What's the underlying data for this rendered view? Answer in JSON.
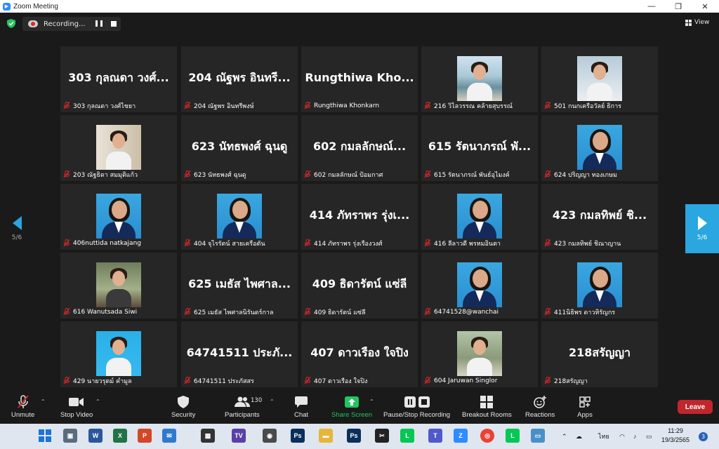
{
  "window": {
    "title": "Zoom Meeting"
  },
  "recording": {
    "label": "Recording..."
  },
  "view": {
    "label": "View"
  },
  "pager": {
    "left": "5/6",
    "right": "5/6"
  },
  "tiles": [
    {
      "big": "303 กุลณดา  วงศ์...",
      "name": "303 กุลณดา  วงศ์ไชยา"
    },
    {
      "big": "204 ณัฐพร อินทรี...",
      "name": "204 ณัฐพร อินทรีพงษ์"
    },
    {
      "big": "Rungthiwa  Kho...",
      "name": "Rungthiwa Khonkarn"
    },
    {
      "big": "",
      "name": "216 วิไลวรรณ คล้ายสุบรรณ์",
      "photo": "photo1"
    },
    {
      "big": "",
      "name": "501 กนกเครือวัลย์ ธิการ",
      "photo": "photo2"
    },
    {
      "big": "",
      "name": "203 ณัฐธิดา สมมุติแก้ว",
      "photo": "photo3"
    },
    {
      "big": "623 นัทธพงศ์ ฉุนดู",
      "name": "623 นัทธพงศ์ ฉุนดู"
    },
    {
      "big": "602 กมลลักษณ์...",
      "name": "602 กมลลักษณ์ ป้อมกาศ"
    },
    {
      "big": "615 รัตนาภรณ์ พั...",
      "name": "615 รัตนาภรณ์ พันธ์อุไมงค์"
    },
    {
      "big": "",
      "name": "624 ปริญญา ทองเกษม",
      "photo": "blue"
    },
    {
      "big": "",
      "name": "406nuttida natkajang",
      "photo": "blue"
    },
    {
      "big": "",
      "name": "404 จุไรรัตน์ สายเครือตัน",
      "photo": "blue"
    },
    {
      "big": "414 ภัทราพร รุ่งเ...",
      "name": "414 ภัทราพร รุ่งเรืองวงศ์"
    },
    {
      "big": "",
      "name": "416 ลีลาวดี พรหมอินตา",
      "photo": "blue"
    },
    {
      "big": "423 กมลทิพย์  ชิ...",
      "name": "423 กมลทิพย์ ชิณาญาน"
    },
    {
      "big": "",
      "name": "616 Wanutsada Siwi",
      "photo": "photo4"
    },
    {
      "big": "625 เมธัส ไพศาล...",
      "name": "625 เมธัส ไพศาลนิรันดร์กาล"
    },
    {
      "big": "409 ธิดารัตน์  แซ่ลี",
      "name": "409 ธิดารัตน์  แซ่ลี"
    },
    {
      "big": "",
      "name": "64741528@wanchai",
      "photo": "blue"
    },
    {
      "big": "",
      "name": "411นิธิพร ดาวหิรัญกร",
      "photo": "blue"
    },
    {
      "big": "",
      "name": "429 นายวรุตม์ คำมูล",
      "photo": "photo6"
    },
    {
      "big": "64741511 ประภั...",
      "name": "64741511 ประภัสสร"
    },
    {
      "big": "407 ดาวเรือง ใจปิง",
      "name": "407 ดาวเรือง ใจปิง"
    },
    {
      "big": "",
      "name": "604 Jaruwan Singlor",
      "photo": "photo5"
    },
    {
      "big": "218สรัญญา",
      "name": "218สรัญญา"
    }
  ],
  "toolbar": {
    "unmute": "Unmute",
    "stop_video": "Stop Video",
    "security": "Security",
    "participants": "Participants",
    "participants_count": "130",
    "chat": "Chat",
    "share_screen": "Share Screen",
    "pause_stop_recording": "Pause/Stop Recording",
    "breakout_rooms": "Breakout Rooms",
    "reactions": "Reactions",
    "apps": "Apps",
    "leave": "Leave"
  },
  "taskbar": {
    "lang": "ไทย",
    "time": "11:29",
    "date": "19/3/2565",
    "notifications": "3"
  },
  "colors": {
    "share_green": "#22c55e",
    "leave_red": "#c0262c",
    "accent_blue": "#2aa6e0"
  }
}
